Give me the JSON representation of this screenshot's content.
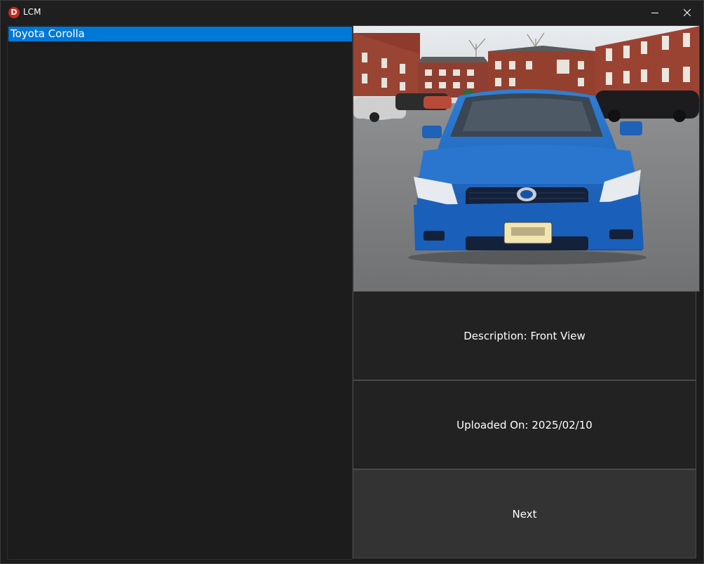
{
  "window": {
    "title": "LCM",
    "app_icon_letter": "D",
    "app_icon_color": "#c42b1c",
    "controls": {
      "minimize_icon": "minimize-icon",
      "close_icon": "close-icon"
    }
  },
  "list": {
    "items": [
      {
        "label": "Toyota Corolla",
        "selected": true
      }
    ],
    "selection_color": "#0078d7"
  },
  "photo": {
    "subject": "car-photo"
  },
  "details": {
    "description": "Description: Front View",
    "uploaded_on": "Uploaded On: 2025/02/10"
  },
  "actions": {
    "next_label": "Next"
  }
}
